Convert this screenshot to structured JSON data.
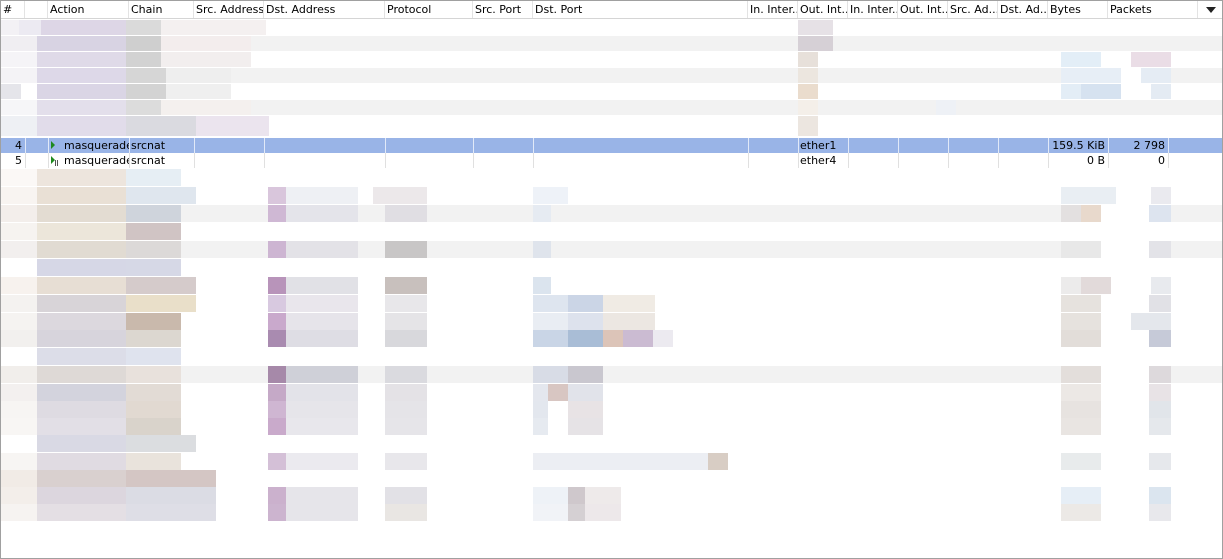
{
  "columns": [
    {
      "label": "#"
    },
    {
      "label": ""
    },
    {
      "label": "Action"
    },
    {
      "label": "Chain"
    },
    {
      "label": "Src. Address"
    },
    {
      "label": "Dst. Address"
    },
    {
      "label": "Protocol"
    },
    {
      "label": "Src. Port"
    },
    {
      "label": "Dst. Port"
    },
    {
      "label": "In. Inter..."
    },
    {
      "label": "Out. Int..."
    },
    {
      "label": "In. Inter..."
    },
    {
      "label": "Out. Int..."
    },
    {
      "label": "Src. Ad..."
    },
    {
      "label": "Dst. Ad..."
    },
    {
      "label": "Bytes"
    },
    {
      "label": "Packets"
    }
  ],
  "rules": [
    {
      "num": "4",
      "action": "masquerade",
      "chain": "srcnat",
      "out_interface": "ether1",
      "bytes": "159.5 KiB",
      "packets": "2 798",
      "selected": true
    },
    {
      "num": "5",
      "action": "masquerade",
      "chain": "srcnat",
      "out_interface": "ether4",
      "bytes": "0 B",
      "packets": "0",
      "selected": false
    }
  ],
  "colors": {
    "selection": "#99b4e7",
    "enabled_icon": "#1f8a1f",
    "header_border": "#d5d5d5"
  },
  "icons": {
    "column_menu": "chevron-down-icon",
    "rule_enabled": "play-pause-icon"
  }
}
